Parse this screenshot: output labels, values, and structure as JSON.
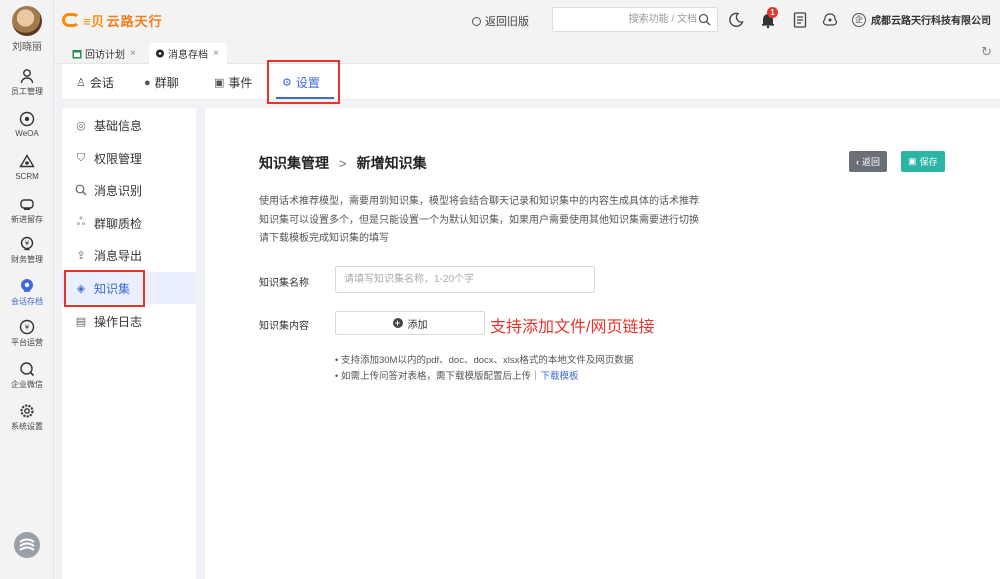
{
  "app": {
    "brand": "云路天行",
    "user_name": "刘晓丽"
  },
  "rail": [
    {
      "label": "员工管理",
      "icon": "person-icon"
    },
    {
      "label": "WeOA",
      "icon": "weoa-icon"
    },
    {
      "label": "SCRM",
      "icon": "scrm-icon"
    },
    {
      "label": "新进留存",
      "icon": "retention-icon"
    },
    {
      "label": "财务管理",
      "icon": "finance-icon"
    },
    {
      "label": "会话存档",
      "icon": "chat-archive-icon",
      "active": true
    },
    {
      "label": "平台运营",
      "icon": "platform-icon"
    },
    {
      "label": "企业微信",
      "icon": "wechat-work-icon"
    },
    {
      "label": "系统设置",
      "icon": "gear-icon"
    }
  ],
  "topbar": {
    "old_version": "返回旧版",
    "search_placeholder": "搜索功能 / 文档",
    "bell_count": "1",
    "company": "成都云路天行科技有限公司"
  },
  "tabs": [
    {
      "label": "回访计划"
    },
    {
      "label": "消息存档",
      "active": true
    }
  ],
  "subnav": [
    {
      "label": "会话",
      "icon": "person-icon"
    },
    {
      "label": "群聊",
      "icon": "group-chat-icon"
    },
    {
      "label": "事件",
      "icon": "event-icon"
    },
    {
      "label": "设置",
      "icon": "settings-icon",
      "active": true
    }
  ],
  "sidemenu": [
    {
      "label": "基础信息",
      "icon": "search-basic-icon"
    },
    {
      "label": "权限管理",
      "icon": "shield-icon"
    },
    {
      "label": "消息识别",
      "icon": "search-icon"
    },
    {
      "label": "群聊质检",
      "icon": "group-icon"
    },
    {
      "label": "消息导出",
      "icon": "export-icon"
    },
    {
      "label": "知识集",
      "icon": "knowledge-icon",
      "active": true
    },
    {
      "label": "操作日志",
      "icon": "log-icon"
    }
  ],
  "main": {
    "breadcrumb_parent": "知识集管理",
    "breadcrumb_sep": ">",
    "breadcrumb_current": "新增知识集",
    "back_label": "返回",
    "save_label": "保存",
    "desc_lines": [
      "使用话术推荐模型，需要用到知识集，模型将会结合聊天记录和知识集中的内容生成具体的话术推荐",
      "知识集可以设置多个，但是只能设置一个为默认知识集，如果用户需要使用其他知识集需要进行切换",
      "请下载模板完成知识集的填写"
    ],
    "name_label": "知识集名称",
    "name_placeholder": "请填写知识集名称，1-20个字",
    "content_label": "知识集内容",
    "add_label": "添加",
    "annotation": "支持添加文件/网页链接",
    "note_1": "• 支持添加30M以内的pdf、doc、docx、xlsx格式的本地文件及网页数据",
    "note_2_text": "• 如需上传问答对表格，需下载模版配置后上传｜",
    "note_2_link": "下载模板"
  },
  "colors": {
    "accent": "#3d6bd6",
    "brand": "#ff8a00",
    "highlight": "#e5332a",
    "save": "#2bb5a4"
  }
}
